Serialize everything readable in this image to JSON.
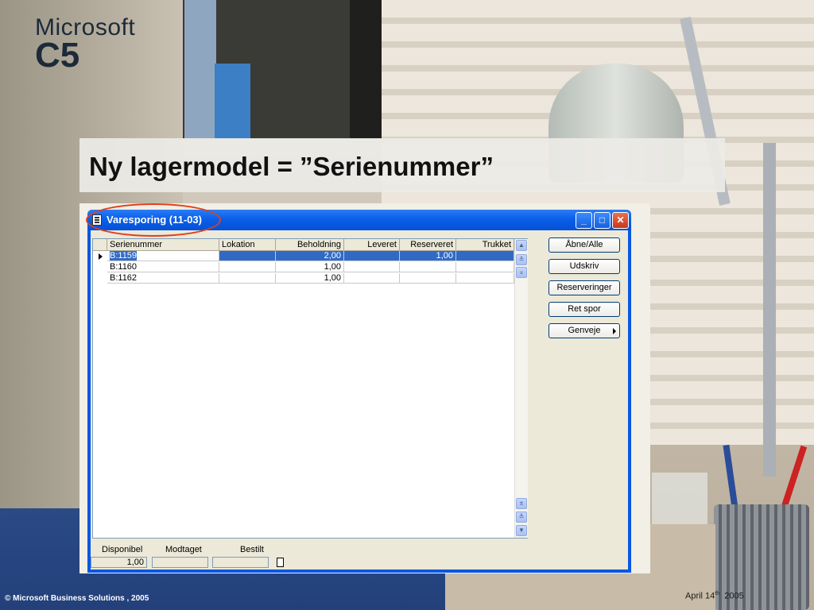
{
  "logo": {
    "brand": "Microsoft",
    "product": "C5"
  },
  "slide": {
    "title": "Ny lagermodel = ”Serienummer”"
  },
  "window": {
    "title": "Varesporing (11-03)",
    "controls": {
      "minimize": "_",
      "maximize": "□",
      "close": "✕"
    }
  },
  "grid": {
    "columns": [
      "Serienummer",
      "Lokation",
      "Beholdning",
      "Leveret",
      "Reserveret",
      "Trukket"
    ],
    "rows": [
      [
        "B:1159",
        "",
        "2,00",
        "",
        "1,00",
        ""
      ],
      [
        "B:1160",
        "",
        "1,00",
        "",
        "",
        ""
      ],
      [
        "B:1162",
        "",
        "1,00",
        "",
        "",
        ""
      ]
    ]
  },
  "buttons": {
    "open_all": "Åbne/Alle",
    "print": "Udskriv",
    "reservations": "Reserveringer",
    "edit_trace": "Ret spor",
    "shortcuts": "Genveje"
  },
  "fields": {
    "available_label": "Disponibel",
    "available_value": "1,00",
    "received_label": "Modtaget",
    "received_value": "",
    "ordered_label": "Bestilt",
    "ordered_value": ""
  },
  "footer": {
    "copyright": "© Microsoft Business Solutions ,  2005",
    "date_prefix": "April 14",
    "date_sup": "th",
    "date_year": "2005"
  }
}
